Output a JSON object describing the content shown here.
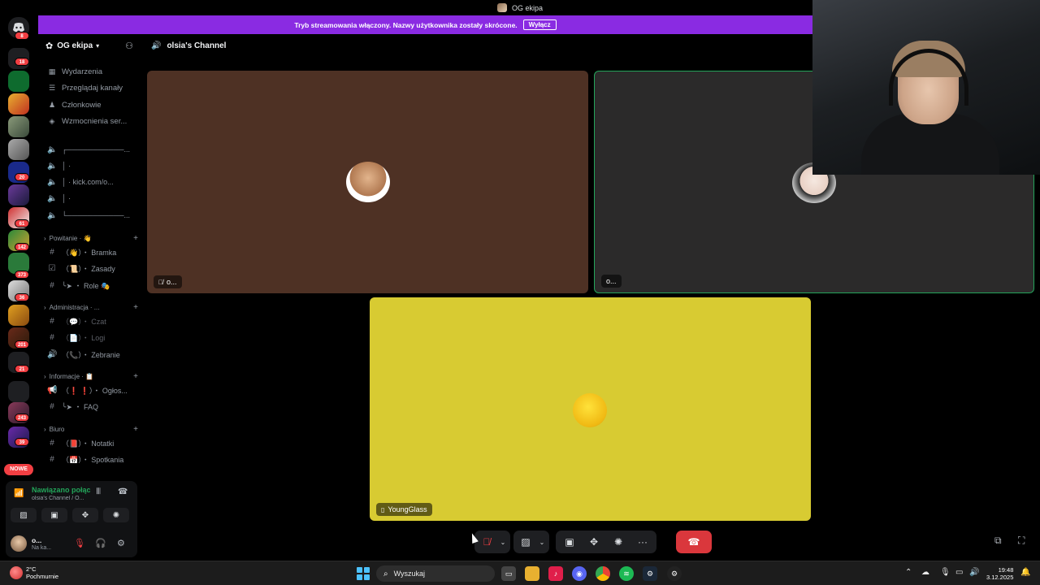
{
  "window": {
    "title": "OG ekipa"
  },
  "banner": {
    "text": "Tryb streamowania włączony. Nazwy użytkownika zostały skrócone.",
    "button": "Wyłącz",
    "color": "#8a2be2"
  },
  "server": {
    "name": "OG ekipa"
  },
  "nav": [
    {
      "label": "Wydarzenia",
      "icon": "calendar-icon"
    },
    {
      "label": "Przeglądaj kanały",
      "icon": "browse-icon"
    },
    {
      "label": "Członkowie",
      "icon": "members-icon"
    },
    {
      "label": "Wzmocnienia ser...",
      "icon": "boost-icon"
    }
  ],
  "voice_channels_top": [
    {
      "label": "┌───────────..."
    },
    {
      "label": "│ ·"
    },
    {
      "label": "│ · kick.com/o..."
    },
    {
      "label": "│ ·"
    },
    {
      "label": "└───────────..."
    }
  ],
  "categories": {
    "powitanie": {
      "label": "Powitanie · 👋",
      "channels": [
        {
          "label": "（👋）・ Bramka",
          "icon": "#"
        },
        {
          "label": "（📜）・ Zasady",
          "icon": "☑"
        },
        {
          "label": "╰➤ ・ Role 🎭",
          "icon": "#"
        }
      ]
    },
    "administracja": {
      "label": "Administracja · ...",
      "channels": [
        {
          "label": "（💬）・ Czat",
          "icon": "#"
        },
        {
          "label": "（📄）・ Logi",
          "icon": "#"
        },
        {
          "label": "（📞）・ Zebranie",
          "icon": "🔊"
        }
      ]
    },
    "informacje": {
      "label": "Informacje · 📋",
      "channels": [
        {
          "label": "（❗ ❗）・ Ogłos...",
          "icon": "📢"
        },
        {
          "label": "╰➤ ・ FAQ",
          "icon": "#"
        }
      ]
    },
    "biuro": {
      "label": "Biuro",
      "channels": [
        {
          "label": "（📕）・ Notatki",
          "icon": "#"
        },
        {
          "label": "（📅）・ Spotkania",
          "icon": "#"
        }
      ]
    }
  },
  "rail_badges": [
    "18",
    "20",
    "61",
    "142",
    "373",
    "36",
    "201",
    "21",
    "243",
    "39"
  ],
  "rail_new": "NOWE",
  "voice_panel": {
    "status": "Nawiązano połączenie",
    "channel": "olsia's Channel / O..."
  },
  "user_panel": {
    "name": "o...",
    "status": "Na ka..."
  },
  "channel_header": {
    "name": "olsia's Channel"
  },
  "tiles": [
    {
      "name": "o...",
      "bg": "#4e3124",
      "muted": true
    },
    {
      "name": "o...",
      "bg": "#2b2a2a",
      "speaking": true
    },
    {
      "name": "YoungGlass",
      "bg": "#d8cb32"
    }
  ],
  "taskbar": {
    "weather_temp": "2°C",
    "weather_desc": "Pochmurnie",
    "search_placeholder": "Wyszukaj",
    "time": "19:48",
    "date": "3.12.2025"
  },
  "colors": {
    "accent": "#5865f2",
    "danger": "#da373c",
    "online": "#23a55a",
    "speaking_border": "#23a55a"
  }
}
